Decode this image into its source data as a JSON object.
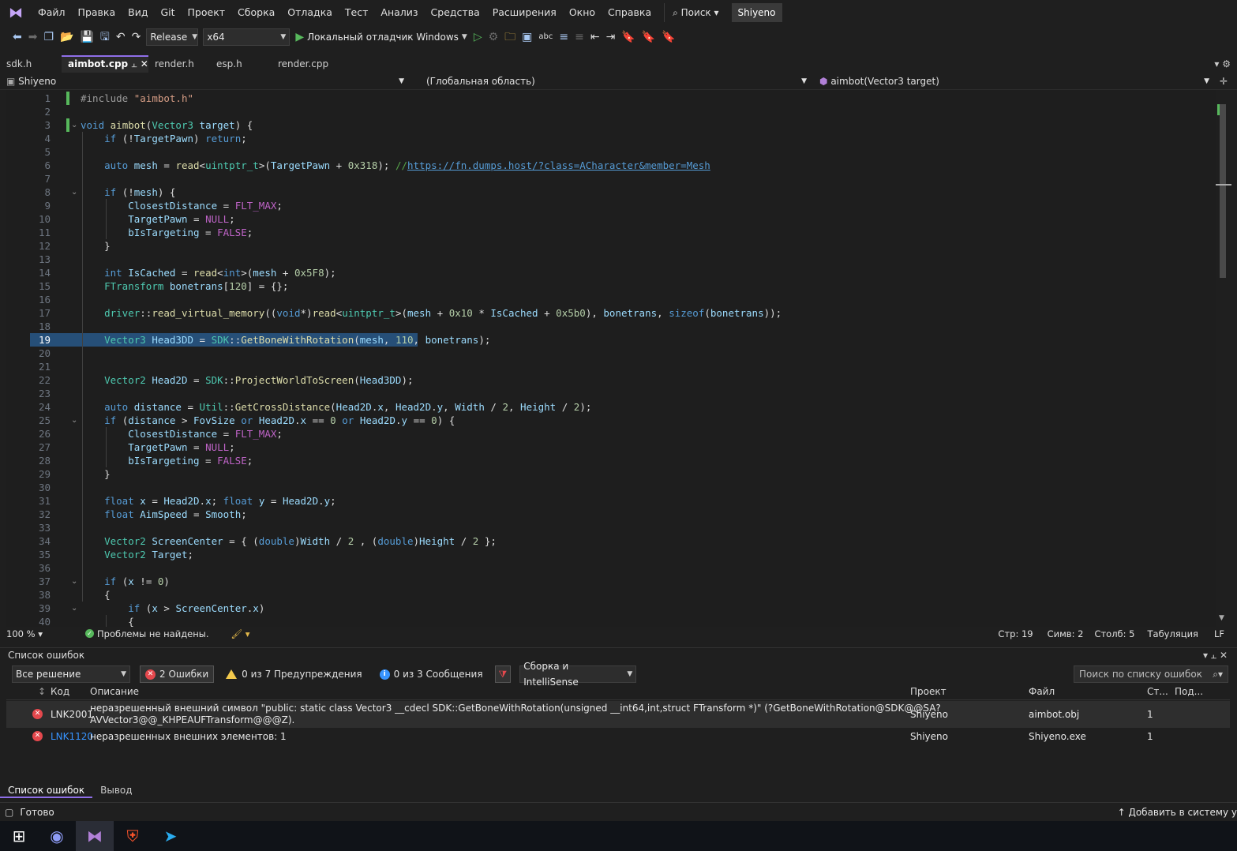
{
  "menubar": {
    "items": [
      "Файл",
      "Правка",
      "Вид",
      "Git",
      "Проект",
      "Сборка",
      "Отладка",
      "Тест",
      "Анализ",
      "Средства",
      "Расширения",
      "Окно",
      "Справка"
    ],
    "search": "Поиск",
    "solution": "Shiyeno"
  },
  "toolbar": {
    "config": "Release",
    "platform": "x64",
    "debugger": "Локальный отладчик Windows"
  },
  "tabs": [
    "sdk.h",
    "aimbot.cpp",
    "render.h",
    "esp.h",
    "render.cpp"
  ],
  "navbar": {
    "project": "Shiyeno",
    "scope": "(Глобальная область)",
    "member": "aimbot(Vector3 target)"
  },
  "editor": {
    "lines": [
      "#include \"aimbot.h\"",
      "",
      "void aimbot(Vector3 target) {",
      "    if (!TargetPawn) return;",
      "",
      "    auto mesh = read<uintptr_t>(TargetPawn + 0x318); //https://fn.dumps.host/?class=ACharacter&member=Mesh",
      "",
      "    if (!mesh) {",
      "        ClosestDistance = FLT_MAX;",
      "        TargetPawn = NULL;",
      "        bIsTargeting = FALSE;",
      "    }",
      "",
      "    int IsCached = read<int>(mesh + 0x5F8);",
      "    FTransform bonetrans[120] = {};",
      "",
      "    driver::read_virtual_memory((void*)read<uintptr_t>(mesh + 0x10 * IsCached + 0x5b0), bonetrans, sizeof(bonetrans));",
      "",
      "    Vector3 Head3DD = SDK::GetBoneWithRotation(mesh, 110, bonetrans);",
      "",
      "",
      "    Vector2 Head2D = SDK::ProjectWorldToScreen(Head3DD);",
      "",
      "    auto distance = Util::GetCrossDistance(Head2D.x, Head2D.y, Width / 2, Height / 2);",
      "    if (distance > FovSize or Head2D.x == 0 or Head2D.y == 0) {",
      "        ClosestDistance = FLT_MAX;",
      "        TargetPawn = NULL;",
      "        bIsTargeting = FALSE;",
      "    }",
      "",
      "    float x = Head2D.x; float y = Head2D.y;",
      "    float AimSpeed = Smooth;",
      "",
      "    Vector2 ScreenCenter = { (double)Width / 2 , (double)Height / 2 };",
      "    Vector2 Target;",
      "",
      "    if (x != 0)",
      "    {",
      "        if (x > ScreenCenter.x)",
      "        {"
    ]
  },
  "status_strip": {
    "zoom": "100 %",
    "problems": "Проблемы не найдены.",
    "row": "Стр: 19",
    "col": "Симв: 2",
    "pos": "Столб: 5",
    "indent": "Табуляция",
    "eol": "LF"
  },
  "errorlist": {
    "title": "Список ошибок",
    "scope": "Все решение",
    "errors_btn": "2 Ошибки",
    "warnings_btn": "0 из 7 Предупреждения",
    "messages_btn": "0 из 3 Сообщения",
    "source": "Сборка и IntelliSense",
    "search": "Поиск по списку ошибок",
    "columns": {
      "code": "Код",
      "desc": "Описание",
      "project": "Проект",
      "file": "Файл",
      "line": "Ст...",
      "sup": "Под..."
    },
    "rows": [
      {
        "code": "LNK2001",
        "desc1": "неразрешенный внешний символ \"public: static class Vector3 __cdecl SDK::GetBoneWithRotation(unsigned __int64,int,struct FTransform *)\" (?GetBoneWithRotation@SDK@@SA?",
        "desc2": "AVVector3@@_KHPEAUFTransform@@@Z).",
        "project": "Shiyeno",
        "file": "aimbot.obj",
        "line": "1"
      },
      {
        "code": "LNK1120",
        "desc1": "неразрешенных внешних элементов: 1",
        "desc2": "",
        "project": "Shiyeno",
        "file": "Shiyeno.exe",
        "line": "1"
      }
    ],
    "tabs": [
      "Список ошибок",
      "Вывод"
    ]
  },
  "statusbar": {
    "ready": "Готово",
    "addsc": "Добавить в систему у"
  },
  "colors": {
    "accent": "#8f6fe8",
    "error": "#e5484d",
    "selection": "#264f78"
  }
}
